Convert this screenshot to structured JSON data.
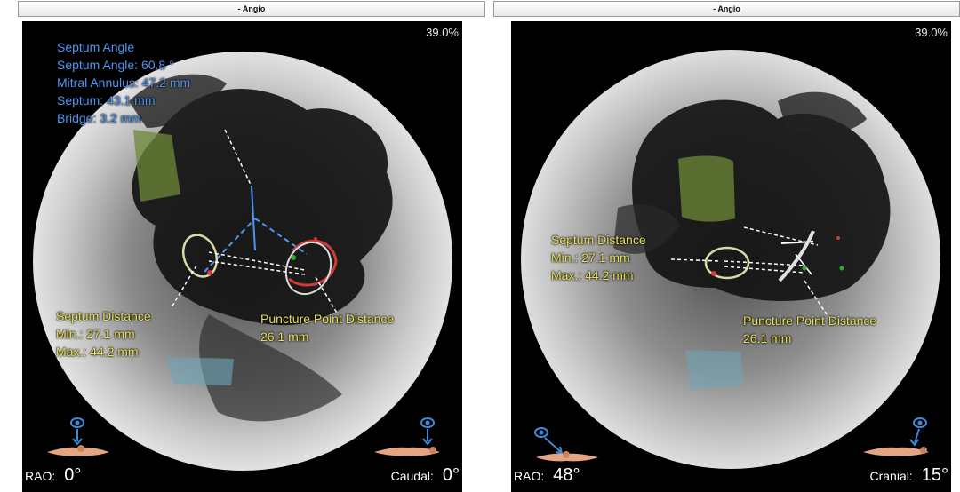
{
  "views": [
    {
      "title": "- Angio",
      "zoom": "39.0%",
      "measurements_blue": [
        "Septum Angle",
        "Septum Angle: 60.8 °",
        "Mitral Annulus: 47.2 mm",
        "Septum: 43.1 mm",
        "Bridge: 3.2 mm"
      ],
      "septum_distance": {
        "title": "Septum Distance",
        "min": "Min.: 27.1 mm",
        "max": "Max.: 44.2 mm"
      },
      "puncture_point": {
        "title": "Puncture Point Distance",
        "value": "26.1 mm"
      },
      "angle_left": {
        "label": "RAO:",
        "value": "0°"
      },
      "angle_right": {
        "label": "Caudal:",
        "value": "0°"
      }
    },
    {
      "title": "- Angio",
      "zoom": "39.0%",
      "septum_distance": {
        "title": "Septum Distance",
        "min": "Min.: 27.1 mm",
        "max": "Max.: 44.2 mm"
      },
      "puncture_point": {
        "title": "Puncture Point Distance",
        "value": "26.1 mm"
      },
      "angle_left": {
        "label": "RAO:",
        "value": "48°"
      },
      "angle_right": {
        "label": "Cranial:",
        "value": "15°"
      }
    }
  ],
  "colors": {
    "measure_blue": "#4f95f0",
    "measure_yellow": "#e6e05a",
    "panel_bg": "#000000",
    "eye_icon": "#3d8ad6"
  },
  "icons": [
    "eye-icon",
    "patient-orientation-icon"
  ]
}
